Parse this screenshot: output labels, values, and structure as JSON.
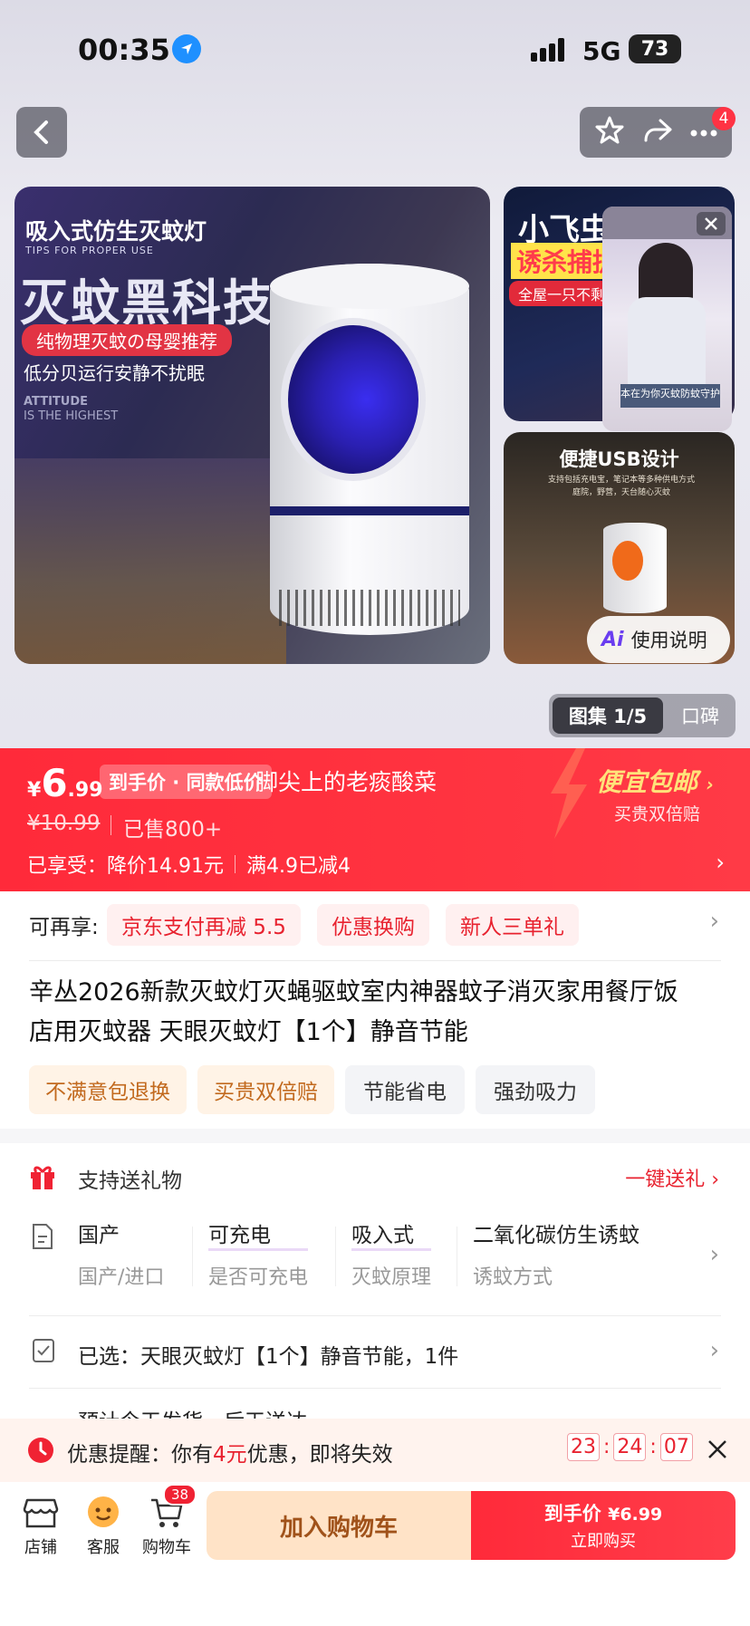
{
  "status": {
    "time": "00:35",
    "signal": "5G",
    "battery": "73"
  },
  "nav": {
    "notif_badge": "4"
  },
  "gallery": {
    "main": {
      "headline_small": "吸入式仿生灭蚊灯",
      "tips": "TIPS FOR PROPER USE",
      "headline_big": "灭蚊黑科技",
      "pill": "纯物理灭蚊の母婴推荐",
      "sub": "低分贝运行安静不扰眠",
      "attitude1": "ATTITUDE",
      "attitude2": "IS THE HIGHEST"
    },
    "side_top": {
      "big": "小飞虫",
      "red": "诱杀捕捉",
      "pill": "全屋一只不剩"
    },
    "side_bottom": {
      "title": "便捷USB设计",
      "sub": "支持包括充电宝，笔记本等多种供电方式\n庭院，野营，天台随心灭蚊"
    },
    "video_caption": "本在为你灭蚊防蚊守护",
    "ai_label": "使用说明",
    "tab_gallery": "图集 1/5",
    "tab_reviews": "口碑"
  },
  "price": {
    "currency": "¥",
    "integer": "6",
    "decimal": ".99",
    "tag": "到手价 · 同款低价",
    "shop_overlay": "脚尖上的老痰酸菜",
    "original": "¥10.99",
    "sold": "已售800+",
    "enjoy_label": "已享受：",
    "discount": "降价14.91元",
    "full_reduce": "满4.9已减4",
    "promo_title": "便宜包邮",
    "promo_sub": "买贵双倍赔"
  },
  "more_offers": {
    "label": "可再享:",
    "chips": [
      "京东支付再减 5.5",
      "优惠换购",
      "新人三单礼"
    ]
  },
  "title": {
    "line1": "辛丛2026新款灭蚊灯灭蝇驱蚊室内神器蚊子消灭家用餐厅饭",
    "line2": "店用灭蚊器 天眼灭蚊灯【1个】静音节能"
  },
  "tags": [
    "不满意包退换",
    "买贵双倍赔",
    "节能省电",
    "强劲吸力"
  ],
  "gift": {
    "label": "支持送礼物",
    "action": "一键送礼"
  },
  "specs": [
    {
      "value": "国产",
      "label": "国产/进口"
    },
    {
      "value": "可充电",
      "label": "是否可充电"
    },
    {
      "value": "吸入式",
      "label": "灭蚊原理"
    },
    {
      "value": "二氧化碳仿生诱蚊",
      "label": "诱蚊方式"
    }
  ],
  "selected": {
    "text": "已选：天眼灭蚊灯【1个】静音节能，1件"
  },
  "shipping_partial": "预计今天发货，后天送达",
  "reminder": {
    "prefix": "优惠提醒：你有",
    "amount": "4元",
    "suffix": "优惠，即将失效",
    "h": "23",
    "m": "24",
    "s": "07"
  },
  "bottom": {
    "store": "店铺",
    "service": "客服",
    "cart": "购物车",
    "cart_badge": "38",
    "add_cart": "加入购物车",
    "buy_price_label": "到手价",
    "buy_price": "¥6.99",
    "buy_now": "立即购买"
  },
  "colors": {
    "red": "#ff2a3a",
    "accent_text": "#e8222f",
    "tag_bg": "#fff3e6",
    "tag_text": "#c26a1f"
  }
}
